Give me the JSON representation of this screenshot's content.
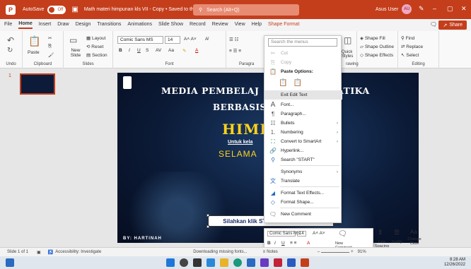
{
  "titlebar": {
    "autosave_label": "AutoSave",
    "autosave_state": "Off",
    "doc_title": "Math materi himpunan kls VII - Copy • Saved to this PC",
    "search_placeholder": "Search (Alt+Q)",
    "user_name": "Asus User",
    "user_initials": "AU",
    "brand_color": "#c43e1c"
  },
  "menu": {
    "tabs": [
      "File",
      "Home",
      "Insert",
      "Draw",
      "Design",
      "Transitions",
      "Animations",
      "Slide Show",
      "Record",
      "Review",
      "View",
      "Help",
      "Shape Format"
    ],
    "active": "Home",
    "share_label": "Share"
  },
  "ribbon": {
    "undo": "Undo",
    "paste": "Paste",
    "clipboard": "Clipboard",
    "new_slide": "New Slide",
    "layout": "Layout",
    "reset": "Reset",
    "section": "Section",
    "slides": "Slides",
    "font_name": "Comic Sans MS",
    "font_size": "14",
    "font": "Font",
    "paragraph": "Paragra",
    "quick_styles": "Quick Styles",
    "drawing": "rawing",
    "shape_fill": "Shape Fill",
    "shape_outline": "Shape Outline",
    "shape_effects": "Shape Effects",
    "find": "Find",
    "replace": "Replace",
    "select": "Select",
    "editing": "Editing"
  },
  "slide_panel": {
    "slide_number": "1"
  },
  "slide": {
    "title_left": "MEDIA PEMBELAJ",
    "title_right": "ATIKA",
    "subtitle": "BERBASIS",
    "main_word": "HIME",
    "untuk_kelas": "Untuk kela",
    "selamat": "SELAMA",
    "start_text": "Silahkan klik START untuk memulai",
    "author": "BY: HARTINAH"
  },
  "context_menu": {
    "search_placeholder": "Search the menus",
    "items": [
      {
        "icon": "cut-icon",
        "label": "Cut",
        "disabled": true
      },
      {
        "icon": "copy-icon",
        "label": "Copy",
        "disabled": true
      },
      {
        "icon": "paste-icon",
        "label": "Paste Options:",
        "bold": true
      },
      {
        "icon": "",
        "label": "Exit Edit Text",
        "highlight": true
      },
      {
        "icon": "font-icon",
        "label": "Font..."
      },
      {
        "icon": "paragraph-icon",
        "label": "Paragraph..."
      },
      {
        "icon": "bullets-icon",
        "label": "Bullets",
        "submenu": true
      },
      {
        "icon": "numbering-icon",
        "label": "Numbering",
        "submenu": true
      },
      {
        "icon": "smartart-icon",
        "label": "Convert to SmartArt",
        "submenu": true
      },
      {
        "icon": "link-icon",
        "label": "Hyperlink..."
      },
      {
        "icon": "search-icon",
        "label": "Search \"START\""
      },
      {
        "icon": "",
        "label": "Synonyms",
        "submenu": true
      },
      {
        "icon": "translate-icon",
        "label": "Translate"
      },
      {
        "icon": "text-effects-icon",
        "label": "Format Text Effects..."
      },
      {
        "icon": "shape-icon",
        "label": "Format Shape..."
      },
      {
        "icon": "comment-icon",
        "label": "New Comment"
      }
    ]
  },
  "mini_toolbar": {
    "font_name": "Comic Sans MS",
    "font_size": "14",
    "new_comment": "New Comment",
    "line_spacing": "Line Spacing",
    "justify": "Justify",
    "change_case": "Change Case"
  },
  "statusbar": {
    "slide_info": "Slide 1 of 1",
    "accessibility": "Accessibility: Investigate",
    "downloading": "Downloading missing fonts...",
    "notes": "Notes",
    "zoom": "91%"
  },
  "taskbar": {
    "time": "8:28 AM",
    "date": "12/26/2022"
  }
}
